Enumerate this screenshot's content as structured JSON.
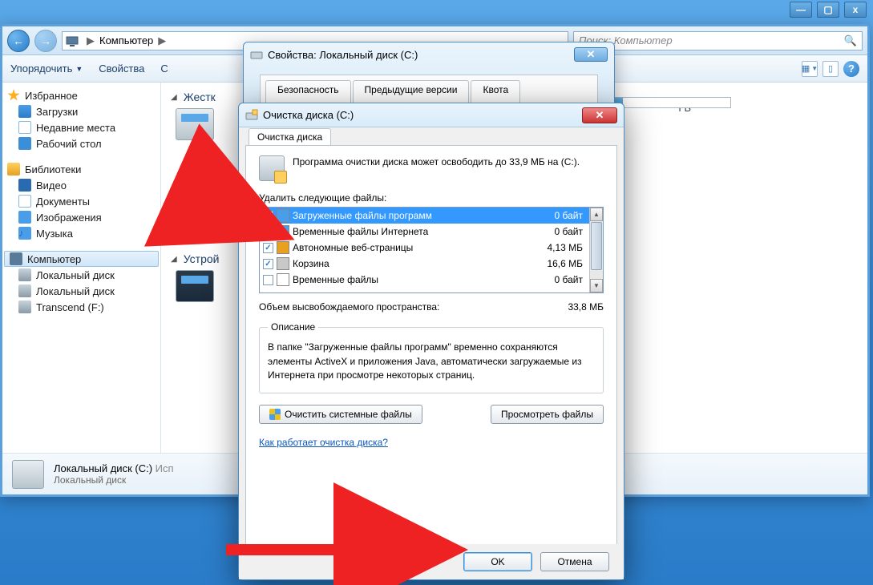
{
  "sys": {
    "min": "—",
    "max": "▢",
    "close": "x"
  },
  "explorer": {
    "path_label": "Компьютер",
    "search_placeholder": "Поиск: Компьютер",
    "toolbar": {
      "organize": "Упорядочить",
      "props": "Свойства",
      "more": "С",
      "help": "?"
    }
  },
  "sidebar": {
    "favorites": "Избранное",
    "downloads": "Загрузки",
    "recent": "Недавние места",
    "desktop": "Рабочий стол",
    "libraries": "Библиотеки",
    "video": "Видео",
    "documents": "Документы",
    "images": "Изображения",
    "music": "Музыка",
    "computer": "Компьютер",
    "local_disk_c": "Локальный диск",
    "local_disk_d": "Локальный диск",
    "transcend": "Transcend (F:)"
  },
  "content": {
    "hdd_header": "Жестк",
    "devices_header": "Устрой",
    "free_suffix": "ГБ"
  },
  "details": {
    "title": "Локальный диск (C:)",
    "used_label": "Исп",
    "subtitle": "Локальный диск"
  },
  "props_dialog": {
    "title": "Свойства: Локальный диск (C:)",
    "tab_security": "Безопасность",
    "tab_prev": "Предыдущие версии",
    "tab_quota": "Квота"
  },
  "cleanup": {
    "title": "Очистка диска  (C:)",
    "tab": "Очистка диска",
    "message": "Программа очистки диска может освободить до 33,9 МБ на  (C:).",
    "delete_label": "Удалить следующие файлы:",
    "files": [
      {
        "name": "Загруженные файлы программ",
        "size": "0 байт",
        "checked": true,
        "selected": true,
        "ico": "#4a9de8"
      },
      {
        "name": "Временные файлы Интернета",
        "size": "0 байт",
        "checked": true,
        "selected": false,
        "ico": "#4a9de8"
      },
      {
        "name": "Автономные веб-страницы",
        "size": "4,13 МБ",
        "checked": true,
        "selected": false,
        "ico": "#e8a020"
      },
      {
        "name": "Корзина",
        "size": "16,6 МБ",
        "checked": true,
        "selected": false,
        "ico": "#c8c8c8"
      },
      {
        "name": "Временные файлы",
        "size": "0 байт",
        "checked": false,
        "selected": false,
        "ico": "#ffffff"
      }
    ],
    "total_label": "Объем высвобождаемого пространства:",
    "total_value": "33,8 МБ",
    "desc_legend": "Описание",
    "desc_text": "В папке \"Загруженные файлы программ\" временно сохраняются элементы ActiveX и приложения Java, автоматически загружаемые из Интернета при просмотре некоторых страниц.",
    "btn_system": "Очистить системные файлы",
    "btn_view": "Просмотреть файлы",
    "link": "Как работает очистка диска?",
    "ok": "OK",
    "cancel": "Отмена"
  }
}
